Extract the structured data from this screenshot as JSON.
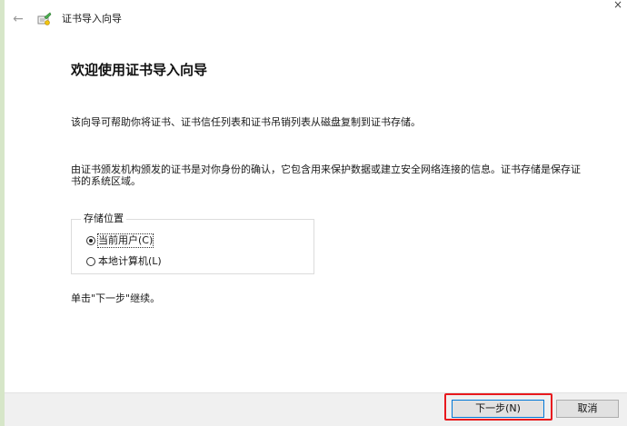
{
  "titlebar": {
    "back_glyph": "←",
    "title": "证书导入向导",
    "close_glyph": "×",
    "icon": "certificate-icon"
  },
  "main": {
    "heading": "欢迎使用证书导入向导",
    "intro": "该向导可帮助你将证书、证书信任列表和证书吊销列表从磁盘复制到证书存储。",
    "description": "由证书颁发机构颁发的证书是对你身份的确认，它包含用来保护数据或建立安全网络连接的信息。证书存储是保存证书的系统区域。",
    "instruction": "单击\"下一步\"继续。"
  },
  "store_location": {
    "legend": "存储位置",
    "options": [
      {
        "label": "当前用户(C)",
        "checked": true
      },
      {
        "label": "本地计算机(L)",
        "checked": false
      }
    ]
  },
  "footer": {
    "next_label": "下一步(N)",
    "cancel_label": "取消"
  },
  "colors": {
    "page_bg": "#d6e6c8",
    "dialog_bg": "#ffffff",
    "footer_bg": "#f0f0f0",
    "focus_border": "#0078d7",
    "highlight": "#e8191e"
  }
}
